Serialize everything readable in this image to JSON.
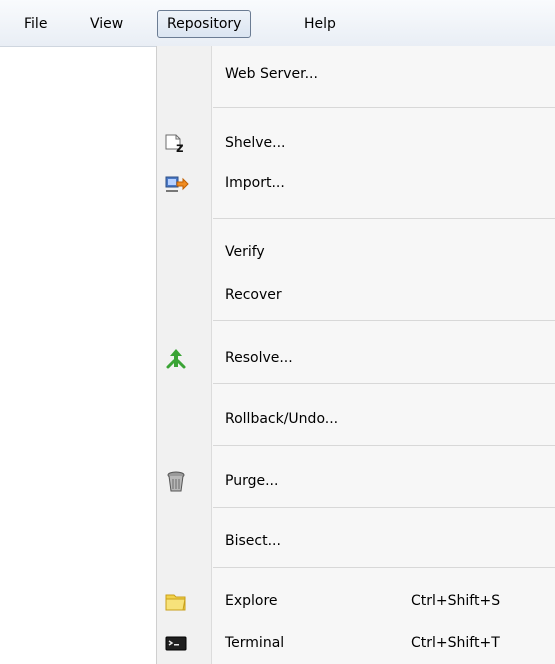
{
  "menubar": {
    "items": [
      "File",
      "View",
      "Repository",
      "Help"
    ]
  },
  "repository_menu": {
    "items": [
      {
        "label": "Web Server..."
      },
      {
        "label": "Shelve...",
        "icon": "shelve-icon"
      },
      {
        "label": "Import...",
        "icon": "import-icon"
      },
      {
        "label": "Verify"
      },
      {
        "label": "Recover"
      },
      {
        "label": "Resolve...",
        "icon": "resolve-icon"
      },
      {
        "label": "Rollback/Undo..."
      },
      {
        "label": "Purge...",
        "icon": "purge-icon"
      },
      {
        "label": "Bisect..."
      },
      {
        "label": "Explore",
        "shortcut": "Ctrl+Shift+S",
        "icon": "folder-icon"
      },
      {
        "label": "Terminal",
        "shortcut": "Ctrl+Shift+T",
        "icon": "terminal-icon"
      }
    ]
  },
  "colors": {
    "menu_background": "#f7f7f7",
    "active_menubar_border": "#6b7c93",
    "resolve_icon": "#3aa335",
    "folder_icon": "#f2d24b"
  }
}
